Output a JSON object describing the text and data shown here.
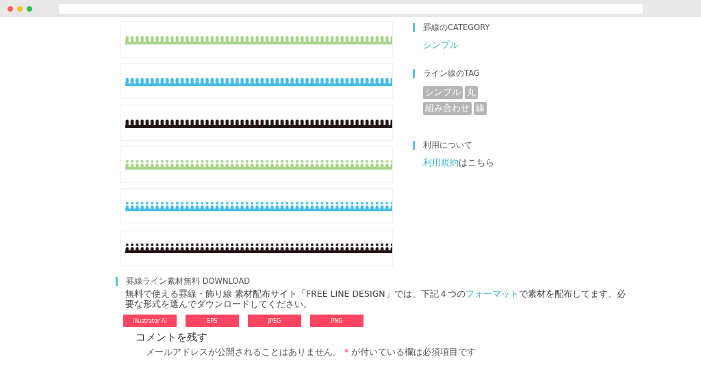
{
  "lines": [
    {
      "kind": "comb",
      "color": "#a8d48a"
    },
    {
      "kind": "comb",
      "color": "#46bde6"
    },
    {
      "kind": "comb",
      "color": "#231815"
    },
    {
      "kind": "dot-comb",
      "color": "#a8d48a"
    },
    {
      "kind": "dot-comb",
      "color": "#46bde6"
    },
    {
      "kind": "dot-comb",
      "color": "#231815"
    }
  ],
  "sidebar": {
    "category": {
      "title": "罫線のCATEGORY",
      "links": [
        "シンプル"
      ]
    },
    "tags": {
      "title": "ライン線のTAG",
      "rows": [
        [
          "シンプル",
          "丸"
        ],
        [
          "組み合わせ",
          "線"
        ]
      ]
    },
    "usage": {
      "title": "利用について",
      "link": "利用規約",
      "rest": "はこちら"
    }
  },
  "download": {
    "title": "罫線ライン素材無料 DOWNLOAD",
    "text_before": "無料で使える罫線・飾り線 素材配布サイト「FREE LINE DESIGN」では、下記４つの",
    "link": "フォーマット",
    "text_after": "で素材を配布してます。必要な形式を選んでダウンロードしてください。",
    "buttons": [
      "illustrator Ai",
      "EPS",
      "JPEG",
      "PNG"
    ]
  },
  "comments": {
    "title": "コメントを残す",
    "note_before": "メールアドレスが公開されることはありません。",
    "required_mark": "*",
    "note_after": "が付いている欄は必須項目です"
  }
}
